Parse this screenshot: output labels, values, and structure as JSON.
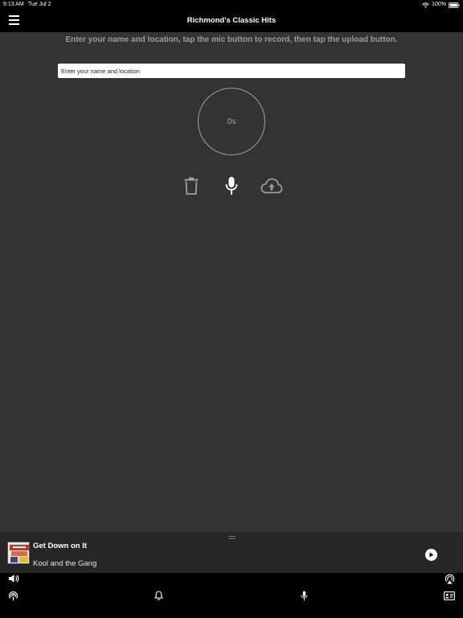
{
  "status_bar": {
    "time": "9:13 AM",
    "date": "Tue Jul 2",
    "battery": "100%",
    "icons": [
      "wifi-icon",
      "battery-icon"
    ]
  },
  "nav": {
    "title": "Richmond's Classic Hits",
    "menu_icon": "hamburger-menu-icon"
  },
  "recorder": {
    "instructions": "Enter your name and location, tap the mic button to record, then tap the upload button.",
    "name_input": {
      "placeholder": "Enter your name and location",
      "value": ""
    },
    "timer": "0s",
    "controls": [
      "trash-icon",
      "microphone-icon",
      "cloud-upload-icon"
    ]
  },
  "now_playing": {
    "title": "Get Down on It",
    "artist": "Kool and the Gang",
    "play_icon": "play-icon"
  },
  "bottom_toolbar": {
    "icons": [
      "speaker-icon",
      "podcast-icon",
      "bell-icon",
      "microphone-icon",
      "airplay-icon",
      "contact-card-icon"
    ]
  },
  "colors": {
    "background": "#333333",
    "bars": "#000000",
    "player": "#262626",
    "instruction_text": "#9a9a9a",
    "icon_gray": "#a0a0a0"
  }
}
